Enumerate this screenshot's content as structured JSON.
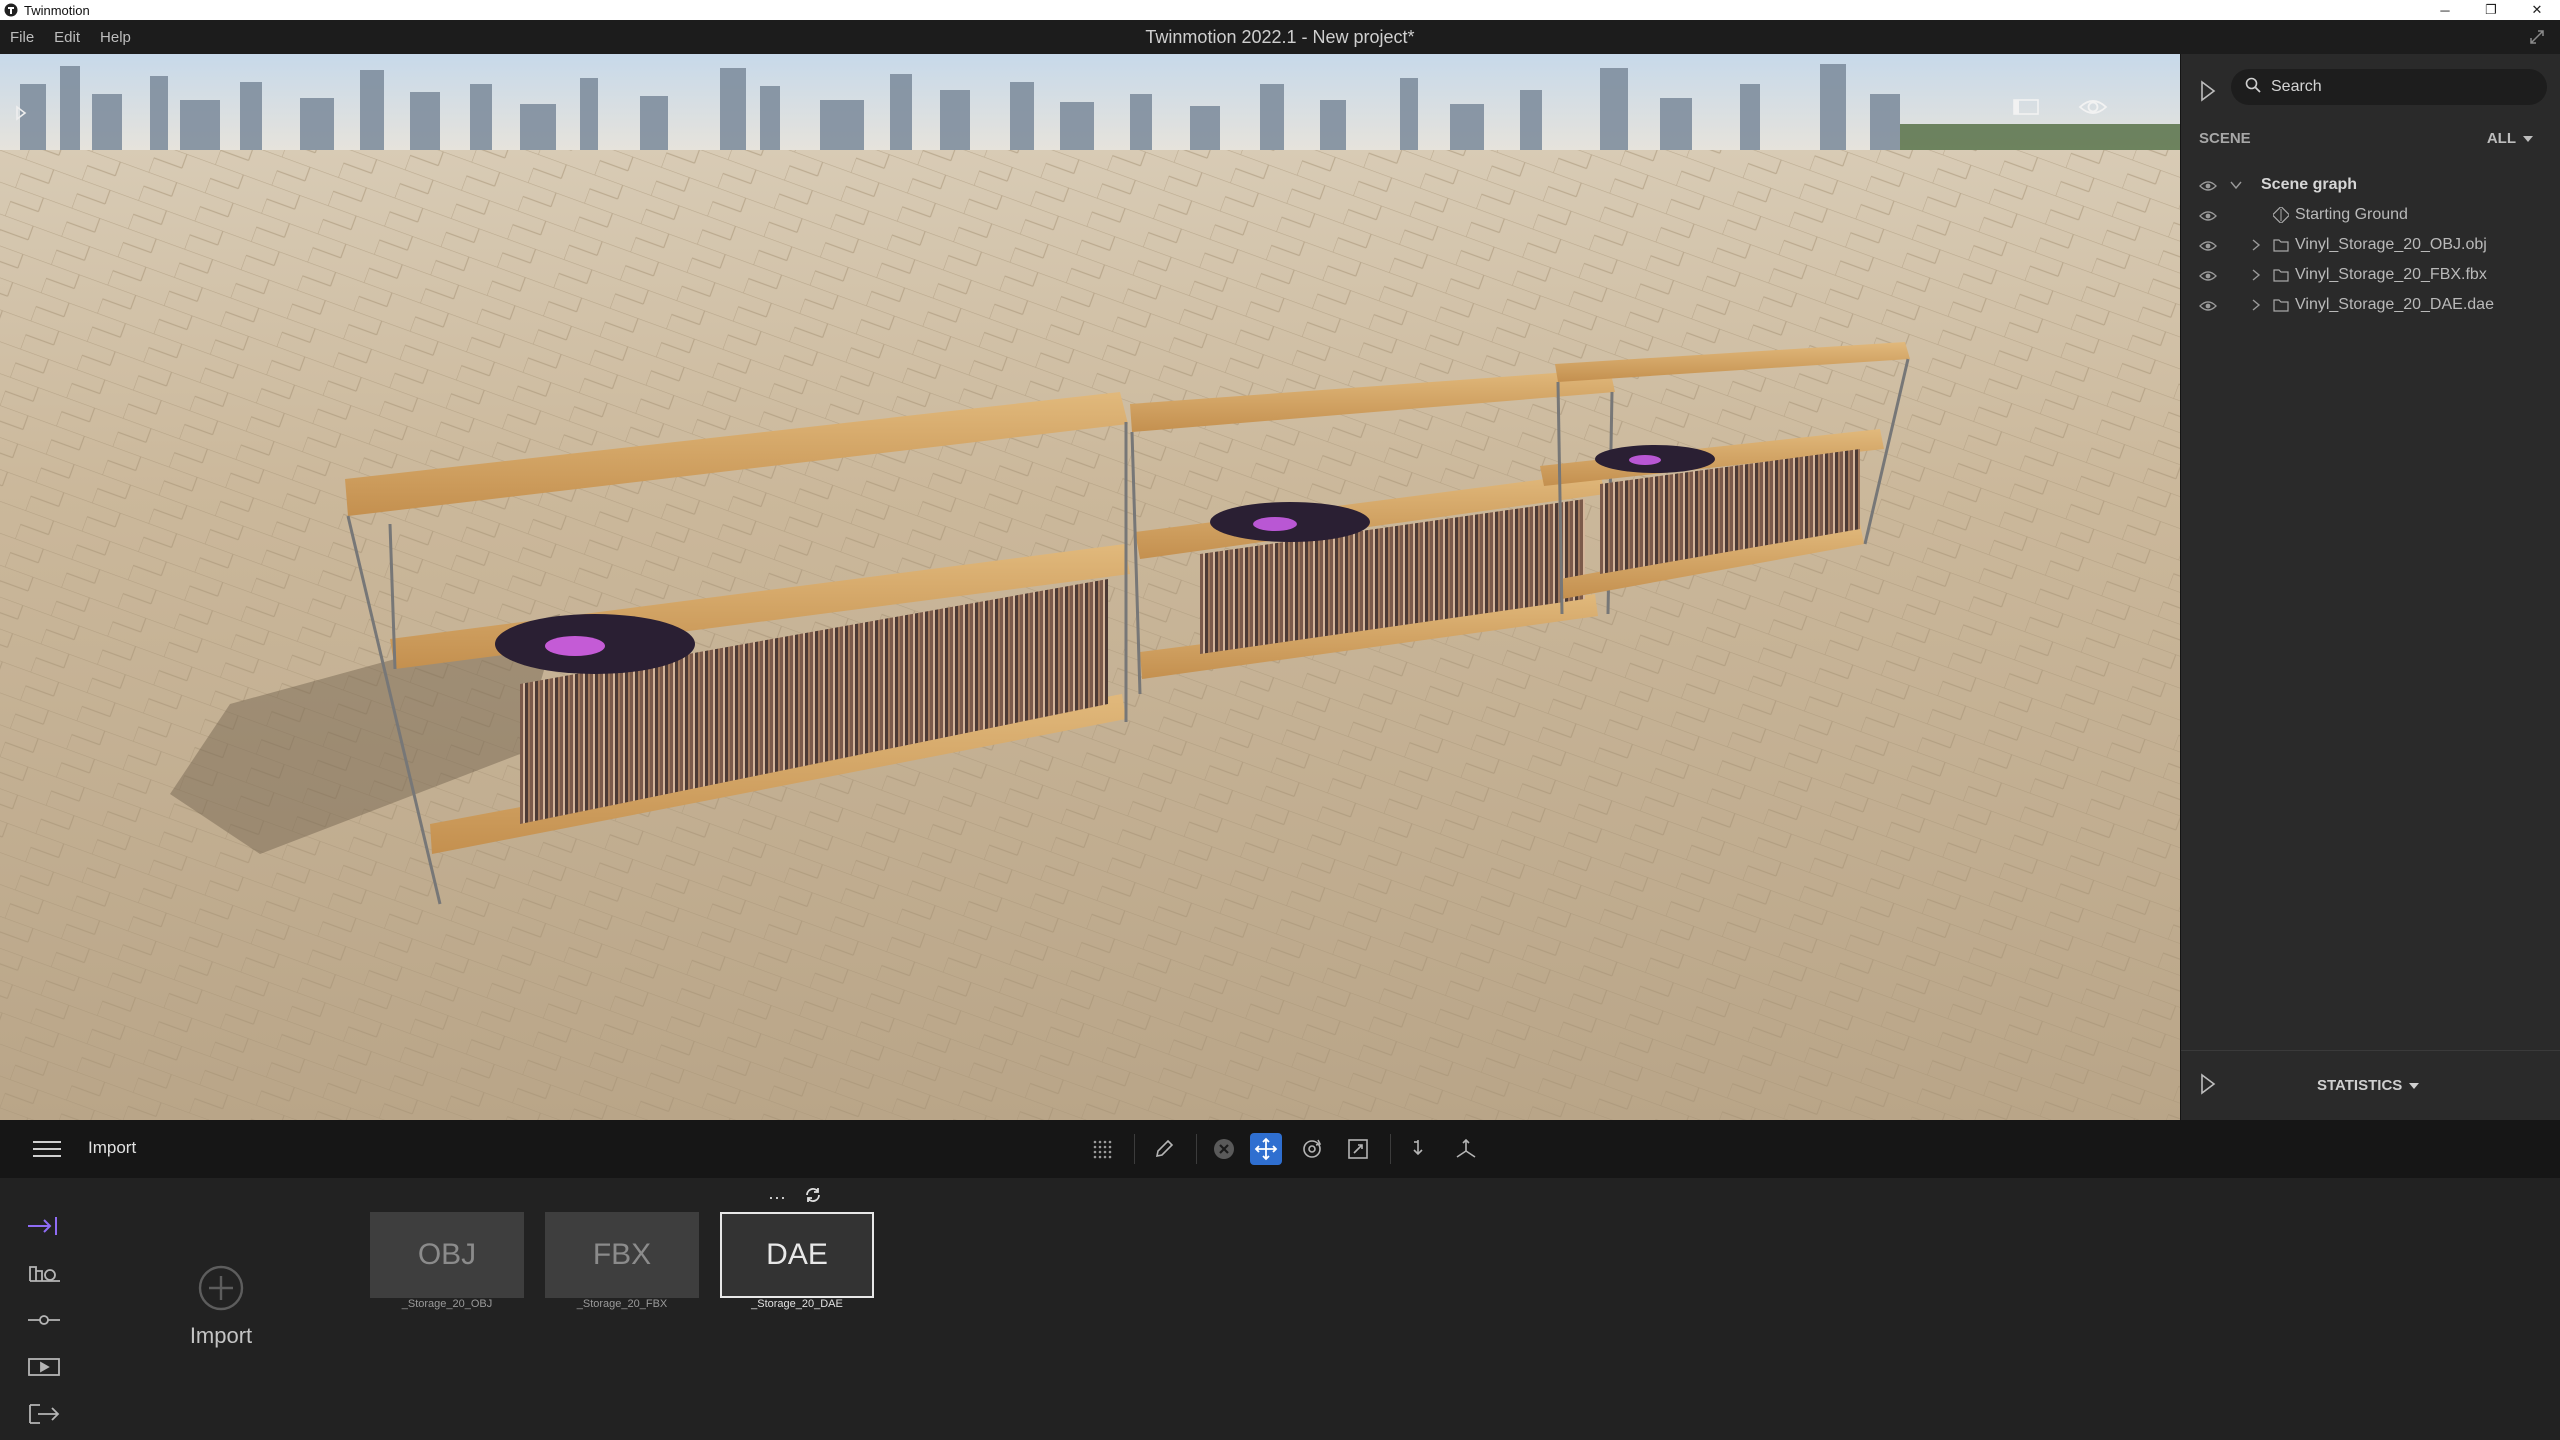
{
  "os_window": {
    "app_name": "Twinmotion",
    "minimize": "─",
    "restore": "❐",
    "close": "✕"
  },
  "menu": {
    "items": [
      "File",
      "Edit",
      "Help"
    ],
    "title": "Twinmotion 2022.1 - New project*"
  },
  "search": {
    "placeholder": "Search"
  },
  "scene_panel": {
    "label": "SCENE",
    "filter": "ALL",
    "tree": {
      "root": "Scene graph",
      "items": [
        {
          "label": "Starting Ground",
          "type": "ground",
          "expandable": false
        },
        {
          "label": "Vinyl_Storage_20_OBJ.obj",
          "type": "folder",
          "expandable": true
        },
        {
          "label": "Vinyl_Storage_20_FBX.fbx",
          "type": "folder",
          "expandable": true
        },
        {
          "label": "Vinyl_Storage_20_DAE.dae",
          "type": "folder",
          "expandable": true
        }
      ]
    },
    "statistics": "STATISTICS"
  },
  "toolbar": {
    "title": "Import",
    "tools": [
      "grid-snap-icon",
      "eyedropper-icon",
      "deselect-icon",
      "move-icon",
      "rotate-icon",
      "scale-icon",
      "drop-to-ground-icon",
      "local-axis-icon"
    ],
    "active_tool": "move-icon",
    "accent": "#2f6fd0"
  },
  "import_panel": {
    "add_label": "Import",
    "tile_more": "···",
    "files": [
      {
        "format": "OBJ",
        "name": "_Storage_20_OBJ",
        "selected": false
      },
      {
        "format": "FBX",
        "name": "_Storage_20_FBX",
        "selected": false
      },
      {
        "format": "DAE",
        "name": "_Storage_20_DAE",
        "selected": true
      }
    ],
    "side_tools": [
      "import-icon",
      "context-icon",
      "settings-icon",
      "media-icon",
      "export-icon"
    ],
    "active_side_tool": "import-icon",
    "accent": "#8f6cf5"
  }
}
